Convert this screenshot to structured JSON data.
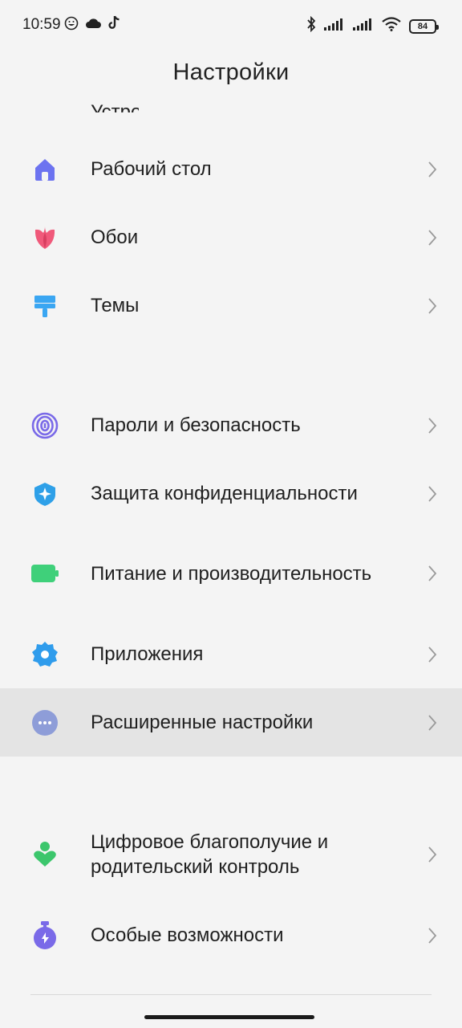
{
  "status_bar": {
    "time": "10:59",
    "battery": "84"
  },
  "header": {
    "title": "Настройки",
    "clipped_item_label": "Устройство"
  },
  "items": [
    {
      "label": "Рабочий стол",
      "icon": "home-icon",
      "color": "#6c73f0"
    },
    {
      "label": "Обои",
      "icon": "tulip-icon",
      "color": "#f0597a"
    },
    {
      "label": "Темы",
      "icon": "brush-icon",
      "color": "#3aa6f2"
    },
    {
      "label": "Пароли и безопасность",
      "icon": "fingerprint-icon",
      "color": "#7a6ae8"
    },
    {
      "label": "Защита конфиденциальности",
      "icon": "shield-icon",
      "color": "#2ea0e8"
    },
    {
      "label": "Питание и производительность",
      "icon": "battery-icon",
      "color": "#3fd07a"
    },
    {
      "label": "Приложения",
      "icon": "gear-icon",
      "color": "#2f9cec"
    },
    {
      "label": "Расширенные настройки",
      "icon": "more-icon",
      "color": "#8e9dd8"
    },
    {
      "label": "Цифровое благополучие и родительский контроль",
      "icon": "wellbeing-icon",
      "color": "#3cc66c"
    },
    {
      "label": "Особые возможности",
      "icon": "accessibility-icon",
      "color": "#7a6ae8"
    }
  ]
}
